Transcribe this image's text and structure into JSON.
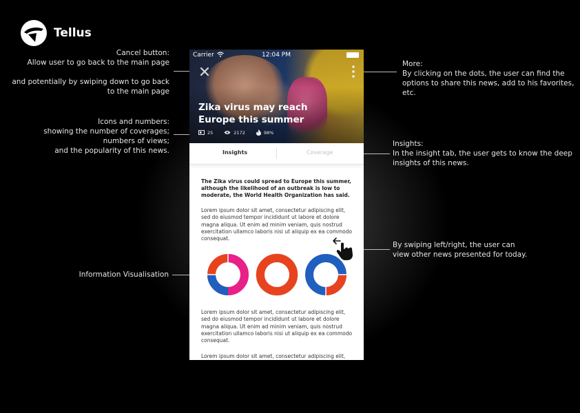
{
  "brand": {
    "name": "Tellus"
  },
  "annotations": {
    "cancel": {
      "title": "Cancel button:",
      "line1": "Allow user to go back to the main page",
      "line2": "and potentially by swiping down to go back",
      "line3": "to the main page"
    },
    "icons": {
      "title": "Icons and numbers:",
      "line1": "showing the number of coverages;",
      "line2": "numbers of views;",
      "line3": "and the popularity of this news."
    },
    "info_vis": "Information Visualisation",
    "more": {
      "title": "More:",
      "line1": "By clicking on the dots, the user can find the",
      "line2": "options to share this news, add to his favorites,",
      "line3": "etc."
    },
    "insights": {
      "title": "Insights:",
      "line1": "In the insight tab, the user gets to know the deep",
      "line2": "insights of this news."
    },
    "swipe": {
      "line1": "By swiping left/right, the user can",
      "line2": "view other news presented for today."
    }
  },
  "phone": {
    "status": {
      "carrier": "Carrier",
      "time": "12:04 PM"
    },
    "article": {
      "title": "Zika virus may reach Europe this summer",
      "coverages": "25",
      "views": "2172",
      "popularity": "98%"
    },
    "tabs": {
      "insights": "Insights",
      "coverage": "Coverage"
    },
    "lead": "The Zika virus could spread to Europe this summer, although the likelihood of an outbreak is low to moderate, the World Health Organization has said.",
    "para1": "Lorem ipsum dolor sit amet, consectetur adipiscing elit, sed do eiusmod tempor incididunt ut labore et dolore magna aliqua. Ut enim ad minim veniam, quis nostrud exercitation ullamco laboris nisi ut aliquip ex ea commodo consequat.",
    "para2": "Lorem ipsum dolor sit amet, consectetur adipiscing elit, sed do eiusmod tempor incididunt ut labore et dolore magna aliqua. Ut enim ad minim veniam, quis nostrud exercitation ullamco laboris nisi ut aliquip ex ea commodo consequat.",
    "para3": "Lorem ipsum dolor sit amet, consectetur adipiscing elit,"
  },
  "icons": {
    "logo": "tellus-logo-icon",
    "close": "close-icon",
    "more": "more-vertical-icon",
    "coverages": "coverage-icon",
    "views": "eye-icon",
    "popularity": "flame-icon",
    "swipe": "swipe-hand-icon"
  },
  "colors": {
    "background": "#000000",
    "orange": "#e8431f",
    "pink": "#e8208a",
    "blue": "#1f5fbf",
    "white": "#ffffff"
  }
}
